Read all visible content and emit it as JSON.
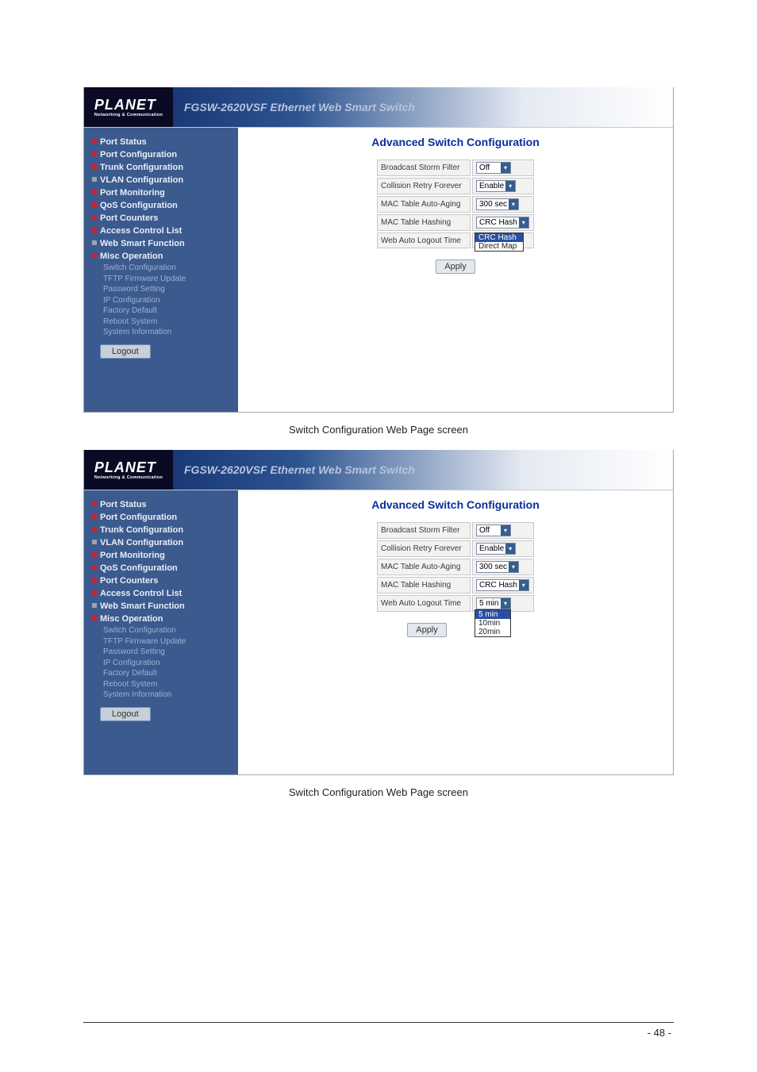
{
  "header": {
    "logo_text": "PLANET",
    "logo_sub": "Networking & Communication",
    "product_title": "FGSW-2620VSF Ethernet Web Smart Switch"
  },
  "sidebar": {
    "items": [
      {
        "label": "Port Status"
      },
      {
        "label": "Port Configuration"
      },
      {
        "label": "Trunk Configuration"
      },
      {
        "label": "VLAN Configuration"
      },
      {
        "label": "Port Monitoring"
      },
      {
        "label": "QoS Configuration"
      },
      {
        "label": "Port Counters"
      },
      {
        "label": "Access Control List"
      },
      {
        "label": "Web Smart Function"
      },
      {
        "label": "Misc Operation"
      }
    ],
    "sub_items": [
      "Switch Configuration",
      "TFTP Firmware Update",
      "Password Setting",
      "IP Configuration",
      "Factory Default",
      "Reboot System",
      "System Information"
    ],
    "logout_label": "Logout"
  },
  "main": {
    "title": "Advanced Switch Configuration",
    "rows": [
      {
        "label": "Broadcast Storm Filter",
        "value": "Off"
      },
      {
        "label": "Collision Retry Forever",
        "value": "Enable"
      },
      {
        "label": "MAC Table Auto-Aging",
        "value": "300 sec"
      },
      {
        "label": "MAC Table Hashing",
        "value": "CRC Hash"
      },
      {
        "label": "Web Auto Logout Time",
        "value": "5 min"
      }
    ],
    "apply_label": "Apply"
  },
  "dropdowns": {
    "hash": {
      "options": [
        "CRC Hash",
        "Direct Map"
      ],
      "selected_index": 0
    },
    "logout": {
      "options": [
        "5 min",
        "10min",
        "20min"
      ],
      "selected_index": 0
    }
  },
  "captions": {
    "c1": "Switch Configuration Web Page screen",
    "c2": "Switch Configuration Web Page screen"
  },
  "footer": {
    "page_number": "- 48 -"
  }
}
